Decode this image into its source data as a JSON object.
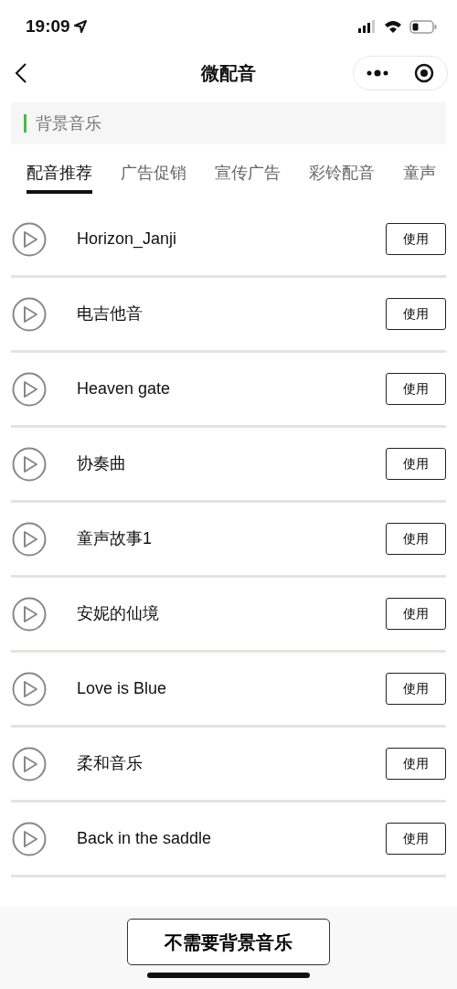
{
  "status_bar": {
    "time": "19:09"
  },
  "nav": {
    "title": "微配音"
  },
  "section": {
    "title": "背景音乐"
  },
  "tabs": [
    {
      "label": "配音推荐",
      "selected": true
    },
    {
      "label": "广告促销",
      "selected": false
    },
    {
      "label": "宣传广告",
      "selected": false
    },
    {
      "label": "彩铃配音",
      "selected": false
    },
    {
      "label": "童声",
      "selected": false
    }
  ],
  "tracks": [
    {
      "title": "Horizon_Janji",
      "button": "使用"
    },
    {
      "title": "电吉他音",
      "button": "使用"
    },
    {
      "title": "Heaven gate",
      "button": "使用"
    },
    {
      "title": "协奏曲",
      "button": "使用"
    },
    {
      "title": "童声故事1",
      "button": "使用"
    },
    {
      "title": "安妮的仙境",
      "button": "使用"
    },
    {
      "title": "Love is Blue",
      "button": "使用"
    },
    {
      "title": "柔和音乐",
      "button": "使用"
    },
    {
      "title": "Back in the saddle",
      "button": "使用"
    }
  ],
  "footer": {
    "button": "不需要背景音乐"
  }
}
